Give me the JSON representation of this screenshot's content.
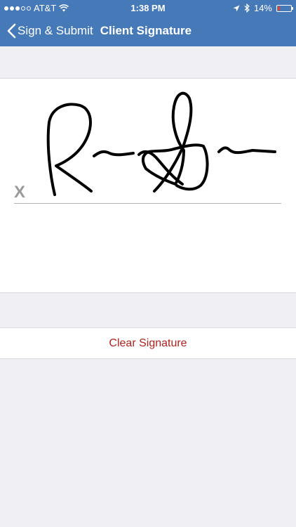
{
  "status_bar": {
    "carrier": "AT&T",
    "time": "1:38 PM",
    "battery": "14%",
    "battery_level": 0.14,
    "signal_bars_filled": 3,
    "signal_bars_total": 5
  },
  "nav": {
    "back_label": "Sign & Submit",
    "title": "Client Signature"
  },
  "signature": {
    "x_mark": "X"
  },
  "actions": {
    "clear_label": "Clear Signature"
  },
  "colors": {
    "nav_background": "#4679b7",
    "page_background": "#efeff4",
    "clear_text": "#b0221e",
    "battery_low": "#e0412f"
  }
}
